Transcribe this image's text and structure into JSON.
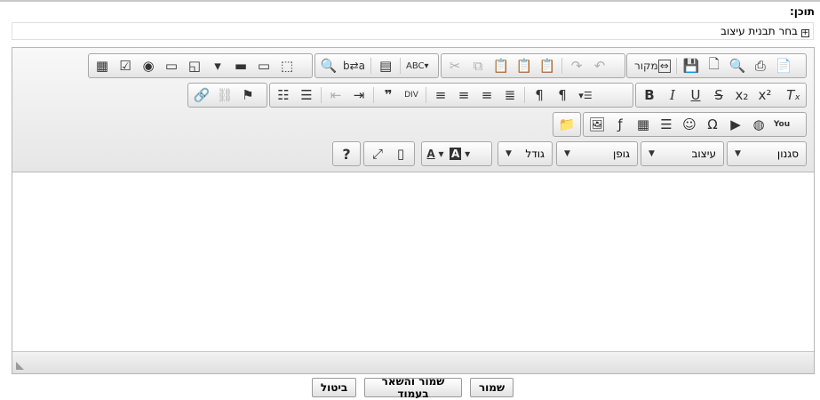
{
  "form": {
    "content_label": "תוכן:",
    "template_selector": "בחר תבנית עיצוב"
  },
  "toolbar": {
    "row1": {
      "source_label": "מקור",
      "document": [
        "save-icon",
        "new-page-icon",
        "preview-icon",
        "print-icon",
        "templates-icon"
      ],
      "clipboard": [
        "cut-icon",
        "copy-icon",
        "paste-icon",
        "paste-text-icon",
        "paste-word-icon",
        "redo-icon",
        "undo-icon"
      ],
      "editing": [
        "find-icon",
        "replace-icon",
        "select-all-icon",
        "spellcheck-icon"
      ],
      "forms": [
        "form-icon",
        "checkbox-icon",
        "radio-icon",
        "textfield-icon",
        "textarea-icon",
        "select-icon",
        "button-icon",
        "imagebutton-icon",
        "hiddenfield-icon"
      ]
    },
    "row2": {
      "basic": [
        "bold-icon",
        "italic-icon",
        "underline-icon",
        "strike-icon",
        "subscript-icon",
        "superscript-icon",
        "remove-format-icon"
      ],
      "paragraph": [
        "numbered-list-icon",
        "bulleted-list-icon",
        "outdent-icon",
        "indent-icon",
        "blockquote-icon",
        "creatediv-icon",
        "align-left-icon",
        "align-center-icon",
        "align-right-icon",
        "justify-icon",
        "ltr-icon",
        "rtl-icon",
        "language-icon"
      ],
      "links": [
        "link-icon",
        "unlink-icon",
        "anchor-icon"
      ]
    },
    "row3": {
      "insert": [
        "image-icon",
        "flash-icon",
        "table-icon",
        "horizontal-rule-icon",
        "smiley-icon",
        "special-char-icon",
        "video-icon",
        "iframe-icon",
        "youtube-icon"
      ],
      "browse": [
        "file-browser-icon"
      ]
    },
    "row4": {
      "styles": "סגנון",
      "format": "עיצוב",
      "font": "גופן",
      "size": "גודל",
      "tools": [
        "maximize-icon",
        "show-blocks-icon"
      ],
      "help": "?"
    }
  },
  "actions": {
    "save": "שמור",
    "save_stay": "שמור והשאר בעמוד",
    "cancel": "ביטול"
  }
}
